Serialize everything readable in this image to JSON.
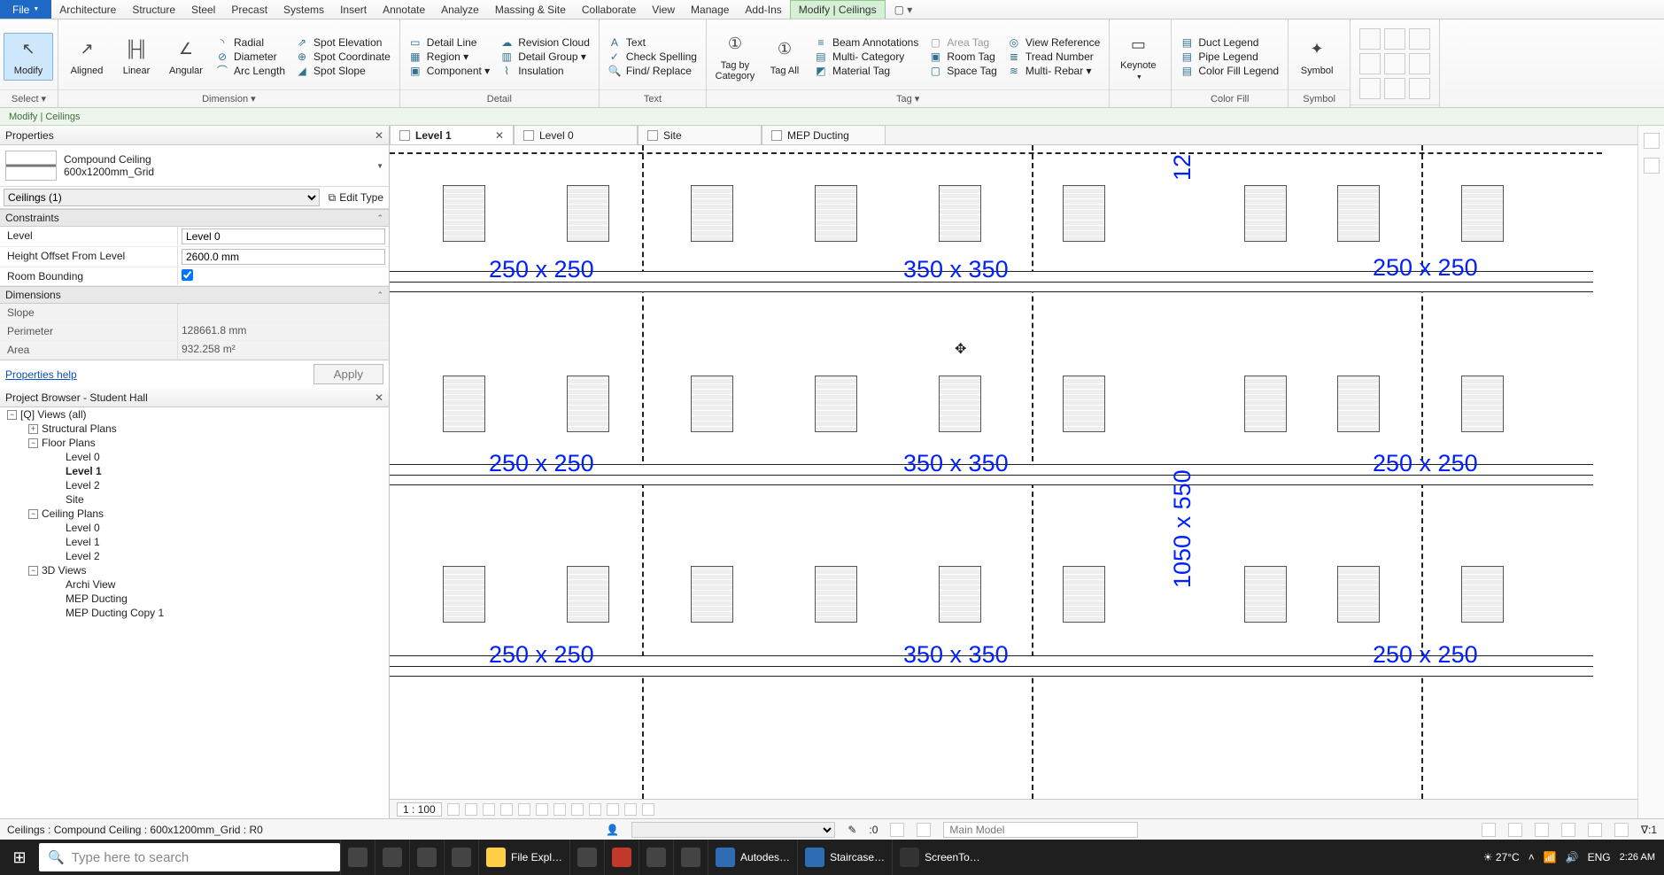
{
  "menubar": {
    "file": "File",
    "items": [
      "Architecture",
      "Structure",
      "Steel",
      "Precast",
      "Systems",
      "Insert",
      "Annotate",
      "Analyze",
      "Massing & Site",
      "Collaborate",
      "View",
      "Manage",
      "Add-Ins"
    ],
    "context": "Modify | Ceilings"
  },
  "ribbon": {
    "groups": {
      "select": {
        "modify": "Modify",
        "label": "Select ▾"
      },
      "dimension_big": [
        "Aligned",
        "Linear",
        "Angular"
      ],
      "dimension_rows": [
        "Radial",
        "Diameter",
        "Arc  Length"
      ],
      "spot_rows": [
        "Spot  Elevation",
        "Spot  Coordinate",
        "Spot  Slope"
      ],
      "dimension_label": "Dimension ▾",
      "detail_rows": [
        "Detail  Line",
        "Region  ▾",
        "Component  ▾"
      ],
      "detail_rows2": [
        "Revision  Cloud",
        "Detail  Group  ▾",
        "Insulation"
      ],
      "detail_label": "Detail",
      "text_rows": [
        "Text",
        "Check  Spelling",
        "Find/  Replace"
      ],
      "text_label": "Text",
      "tagby": {
        "cat": "Tag by Category",
        "all": "Tag All"
      },
      "tag_rows1": [
        "Beam  Annotations",
        "Multi- Category",
        "Material  Tag"
      ],
      "tag_rows2": [
        "Area  Tag",
        "Room  Tag",
        "Space  Tag"
      ],
      "tag_rows3": [
        "View  Reference",
        "Tread  Number",
        "Multi-  Rebar   ▾"
      ],
      "tag_label": "Tag ▾",
      "keynote": "Keynote",
      "colorfill_rows": [
        "Duct  Legend",
        "Pipe  Legend",
        "Color Fill  Legend"
      ],
      "colorfill_label": "Color Fill",
      "symbol": "Symbol",
      "symbol_label": "Symbol"
    }
  },
  "ctxbar": "Modify | Ceilings",
  "properties": {
    "title": "Properties",
    "family": "Compound Ceiling",
    "type": "600x1200mm_Grid",
    "category": "Ceilings (1)",
    "edit_type": "Edit Type",
    "sections": {
      "constraints": "Constraints",
      "dimensions": "Dimensions"
    },
    "rows": {
      "level_k": "Level",
      "level_v": "Level 0",
      "offset_k": "Height Offset From Level",
      "offset_v": "2600.0 mm",
      "roombound_k": "Room Bounding",
      "slope_k": "Slope",
      "slope_v": "",
      "perimeter_k": "Perimeter",
      "perimeter_v": "128661.8 mm",
      "area_k": "Area",
      "area_v": "932.258 m²"
    },
    "help": "Properties help",
    "apply": "Apply"
  },
  "browser": {
    "title": "Project Browser - Student Hall",
    "root": "Views (all)",
    "struct": "Structural Plans",
    "floor": "Floor Plans",
    "floor_items": [
      "Level 0",
      "Level 1",
      "Level 2",
      "Site"
    ],
    "floor_bold_index": 1,
    "ceiling": "Ceiling Plans",
    "ceiling_items": [
      "Level 0",
      "Level 1",
      "Level 2"
    ],
    "threeD": "3D Views",
    "threeD_items": [
      "Archi View",
      "MEP Ducting",
      "MEP Ducting Copy 1"
    ]
  },
  "viewtabs": [
    {
      "name": "Level 1",
      "active": true,
      "closable": true
    },
    {
      "name": "Level 0",
      "active": false,
      "closable": false
    },
    {
      "name": "Site",
      "active": false,
      "closable": false
    },
    {
      "name": "MEP Ducting",
      "active": false,
      "closable": false
    }
  ],
  "canvas": {
    "labels": {
      "a": "250 x 250",
      "b": "350 x 350",
      "c": "250 x 250",
      "v1": "1050 x 550",
      "v2": "12"
    }
  },
  "viewctl": {
    "scale": "1 : 100"
  },
  "status": {
    "selection": "Ceilings : Compound Ceiling : 600x1200mm_Grid : R0",
    "zero": ":0",
    "mainmodel": "Main Model",
    "filter": ":1"
  },
  "taskbar": {
    "search_placeholder": "Type here to search",
    "items": [
      "File Expl…",
      "",
      "",
      "",
      "",
      "Autodes…",
      "Staircase…",
      "ScreenTo…"
    ],
    "weather": "27°C",
    "lang": "ENG",
    "time": "2:26 AM"
  }
}
